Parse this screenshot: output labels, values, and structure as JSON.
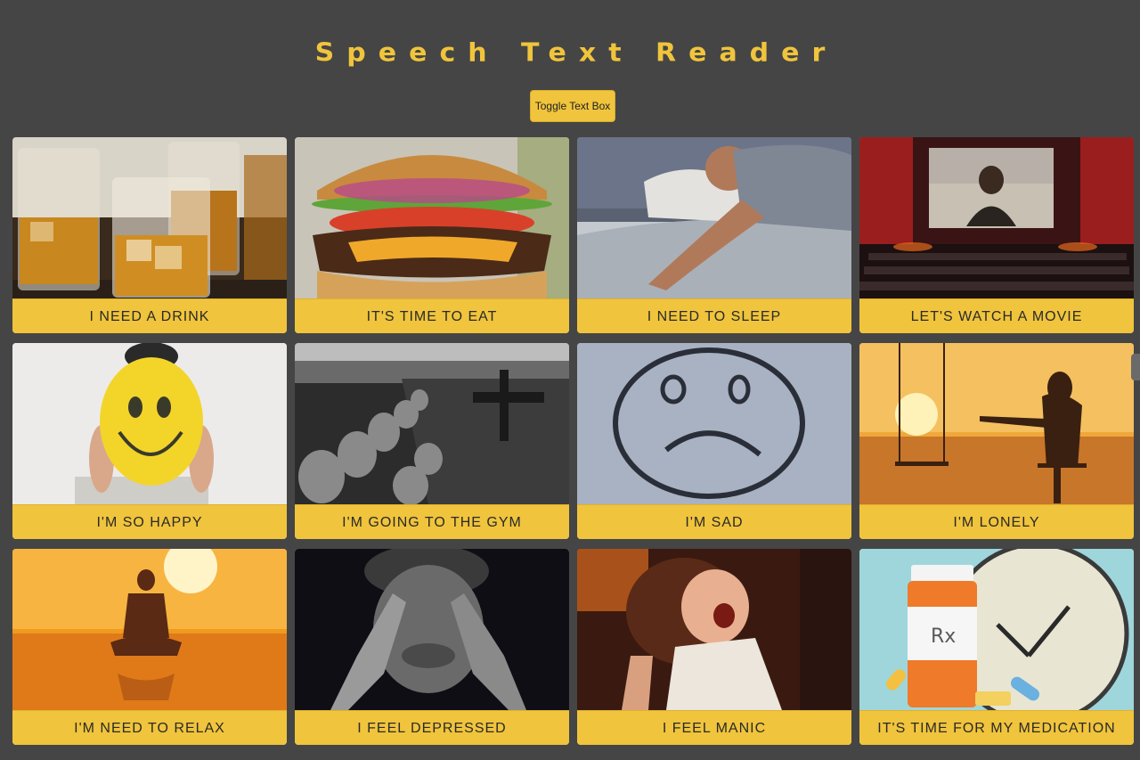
{
  "app": {
    "title": "Speech Text Reader",
    "toggle_button_label": "Toggle Text Box"
  },
  "colors": {
    "background": "#454545",
    "accent": "#f0c43c"
  },
  "cards": [
    {
      "label": "I NEED A DRINK",
      "image": "whiskey-glasses-image"
    },
    {
      "label": "IT'S TIME TO EAT",
      "image": "burger-image"
    },
    {
      "label": "I NEED TO SLEEP",
      "image": "sleeping-man-image"
    },
    {
      "label": "LET'S WATCH A MOVIE",
      "image": "cinema-image"
    },
    {
      "label": "I'M SO HAPPY",
      "image": "smiley-balloon-image"
    },
    {
      "label": "I'M GOING TO THE GYM",
      "image": "gym-dumbbells-image"
    },
    {
      "label": "I'M SAD",
      "image": "sad-face-sand-image"
    },
    {
      "label": "I'M LONELY",
      "image": "swing-sunset-image"
    },
    {
      "label": "I'M NEED TO RELAX",
      "image": "meditation-sunset-image"
    },
    {
      "label": "I FEEL DEPRESSED",
      "image": "head-in-hands-image"
    },
    {
      "label": "I FEEL MANIC",
      "image": "screaming-woman-image"
    },
    {
      "label": "IT'S TIME FOR MY MEDICATION",
      "image": "pills-clock-image"
    }
  ]
}
